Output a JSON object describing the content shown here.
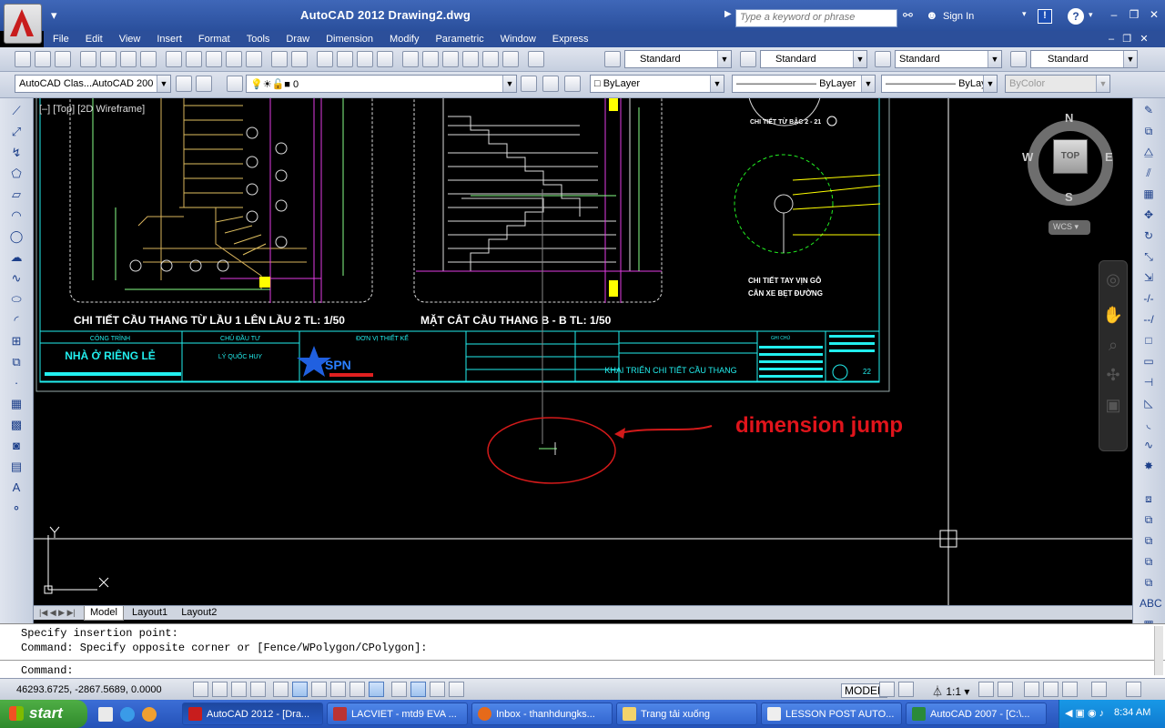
{
  "window": {
    "title": "AutoCAD 2012    Drawing2.dwg",
    "search_placeholder": "Type a keyword or phrase",
    "sign_in": "Sign In"
  },
  "menu": [
    "File",
    "Edit",
    "View",
    "Insert",
    "Format",
    "Tools",
    "Draw",
    "Dimension",
    "Modify",
    "Parametric",
    "Window",
    "Express"
  ],
  "styles_toolbar": {
    "text_style": "Standard",
    "dim_style": "Standard",
    "table_style": "Standard",
    "mleader_style": "Standard"
  },
  "layers_toolbar": {
    "workspace": "AutoCAD Clas...AutoCAD 200",
    "layer": "0",
    "color": "ByLayer",
    "linetype": "ByLayer",
    "lineweight": "ByLayer",
    "plotstyle": "ByColor"
  },
  "viewport": {
    "label": "[–] [Top] [2D Wireframe]",
    "viewcube": {
      "top": "TOP",
      "n": "N",
      "s": "S",
      "e": "E",
      "w": "W",
      "ucs": "WCS"
    }
  },
  "drawing": {
    "caption_left": "CHI TIẾT CẦU THANG TỪ LẦU 1 LÊN LẦU 2 TL: 1/50",
    "caption_mid": "MẶT CẮT CẦU THANG B - B  TL: 1/50",
    "detail_title": "CHI TIẾT TỪ BẬC 2 - 21",
    "detail_caption_1": "CHI TIẾT TAY VỊN GỖ",
    "detail_caption_2": "CÂN XE BẸT ĐƯỜNG",
    "title_block": {
      "project_label": "CÔNG TRÌNH",
      "project": "NHÀ Ở RIÊNG LẺ",
      "owner_label": "CHỦ ĐẦU TƯ",
      "owner": "LÝ QUỐC HUY",
      "designer_label": "ĐƠN VỊ THIẾT KẾ",
      "designer_logo": "SPN",
      "sheet_title": "KHAI TRIỂN CHI TIẾT CẦU THANG",
      "notes_label": "GHI CHÚ",
      "sheet_no": "22"
    }
  },
  "annotation": {
    "text": "dimension jump",
    "color": "#e0141b"
  },
  "tabs": [
    "Model",
    "Layout1",
    "Layout2"
  ],
  "command": {
    "history_1": "Specify insertion point:",
    "history_2": "Command: Specify opposite corner or [Fence/WPolygon/CPolygon]:",
    "prompt": "Command:"
  },
  "status": {
    "coords": "46293.6725, -2867.5689, 0.0000",
    "model": "MODEL",
    "scale": "1:1"
  },
  "taskbar": {
    "start": "start",
    "tasks": [
      {
        "label": "AutoCAD 2012 - [Dra...",
        "active": true
      },
      {
        "label": "LACVIET - mtd9 EVA ...",
        "active": false
      },
      {
        "label": "Inbox - thanhdungks...",
        "active": false
      },
      {
        "label": "Trang tải xuống",
        "active": false
      },
      {
        "label": "LESSON POST AUTO...",
        "active": false
      },
      {
        "label": "AutoCAD 2007 - [C:\\...",
        "active": false
      }
    ],
    "clock": "8:34 AM"
  }
}
